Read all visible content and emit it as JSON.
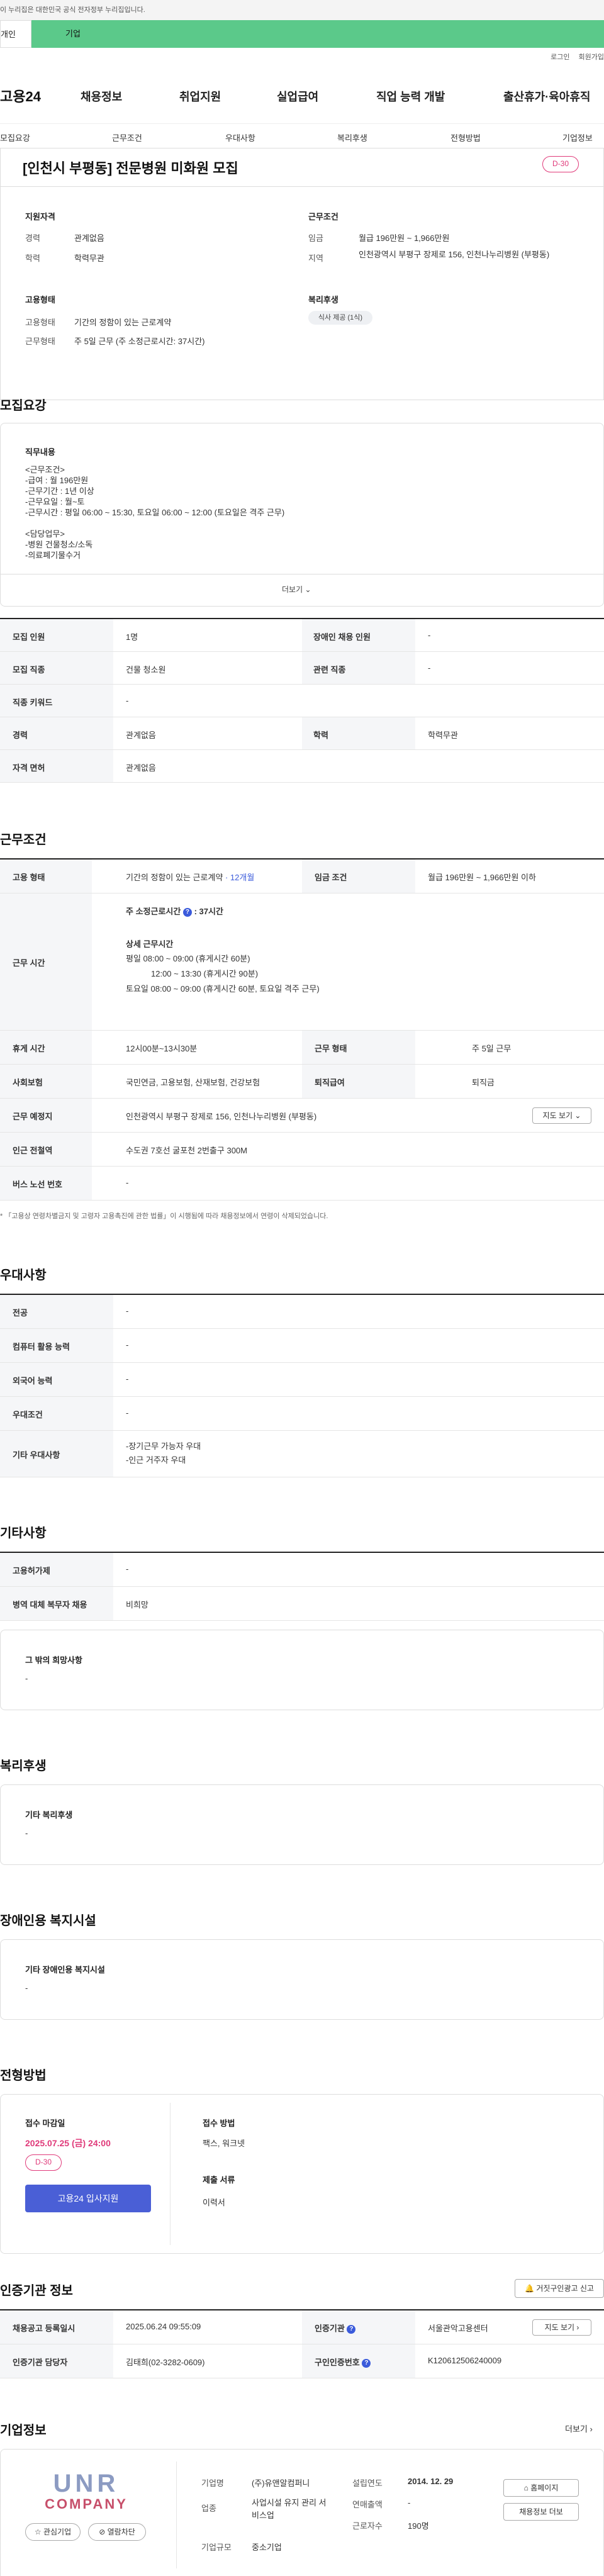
{
  "gov_banner": "이 누리집은 대한민국 공식 전자정부 누리집입니다.",
  "top_tabs": [
    "개인",
    "기업"
  ],
  "top_links": [
    "로그인",
    "회원가입"
  ],
  "logo": "고용24",
  "gnb": [
    "채용정보",
    "취업지원",
    "실업급여",
    "직업 능력 개발",
    "출산휴가·육아휴직"
  ],
  "snb": [
    "모집요강",
    "근무조건",
    "우대사항",
    "복리후생",
    "전형방법",
    "기업정보"
  ],
  "header": {
    "title": "[인천시 부평동] 전문병원 미화원 모집",
    "dday": "D-30"
  },
  "summary": {
    "qual_title": "지원자격",
    "career_label": "경력",
    "career_value": "관계없음",
    "edu_label": "학력",
    "edu_value": "학력무관",
    "cond_title": "근무조건",
    "wage_label": "임금",
    "wage_value": "월급 196만원 ~ 1,966만원",
    "region_label": "지역",
    "region_value": "인천광역시 부평구 장제로 156, 인천나누리병원 (부평동)",
    "emp_title": "고용형태",
    "emptype_label": "고용형태",
    "emptype_value": "기간의 정함이 있는 근로계약",
    "worktype_label": "근무형태",
    "worktype_value": "주 5일 근무 (주 소정근로시간: 37시간)",
    "welfare_title": "복리후생",
    "welfare_badge": "식사 제공 (1식)"
  },
  "recruit": {
    "section": "모집요강",
    "duty_title": "직무내용",
    "duty_lines": [
      "<근무조건>",
      "-급여 : 월 196만원",
      "-근무기간 : 1년 이상",
      "-근무요일 : 월~토",
      "-근무시간 : 평일 06:00 ~ 15:30, 토요일 06:00 ~ 12:00 (토요일은 격주 근무)",
      "",
      "<담당업무>",
      "-병원 건물청소/소독",
      "-의료폐기물수거"
    ],
    "more": "더보기",
    "rows": [
      {
        "k1": "모집 인원",
        "v1": "1명",
        "k2": "장애인 채용 인원",
        "v2": "-"
      },
      {
        "k1": "모집 직종",
        "v1": "건물 청소원",
        "k2": "관련 직종",
        "v2": "-"
      },
      {
        "k1": "직종 키워드",
        "v1": "-"
      },
      {
        "k1": "경력",
        "v1": "관계없음",
        "k2": "학력",
        "v2": "학력무관"
      },
      {
        "k1": "자격 면허",
        "v1": "관계없음"
      }
    ]
  },
  "workcond": {
    "section": "근무조건",
    "emp_label": "고용 형태",
    "emp_value": "기간의 정함이 있는 근로계약",
    "emp_months": "· 12개월",
    "wage_label": "임금 조건",
    "wage_value": "월급 196만원 ~ 1,966만원 이하",
    "time_label": "근무 시간",
    "weekly": "주 소정근로시간",
    "weekly_hours": ": 37시간",
    "detail_title": "상세 근무시간",
    "detail_lines": [
      "평일 08:00 ~ 09:00 (휴게시간 60분)",
      "12:00 ~ 13:30 (휴게시간 90분)",
      "토요일 08:00 ~ 09:00 (휴게시간 60분, 토요일 격주 근무)"
    ],
    "break_label": "휴게 시간",
    "break_value": "12시00분~13시30분",
    "form_label": "근무 형태",
    "form_value": "주 5일 근무",
    "ins_label": "사회보험",
    "ins_value": "국민연금, 고용보험, 산재보험, 건강보험",
    "sev_label": "퇴직급여",
    "sev_value": "퇴직금",
    "place_label": "근무 예정지",
    "place_value": "인천광역시 부평구 장제로 156, 인천나누리병원 (부평동)",
    "map_btn": "지도 보기",
    "station_label": "인근 전철역",
    "station_value": "수도권 7호선 굴포천 2번출구 300M",
    "bus_label": "버스 노선 번호",
    "bus_value": "-",
    "note": "* 「고용상 연령차별금지 및 고령자 고용촉진에 관한 법률」이 시행됨에 따라 채용정보에서 연령이 삭제되었습니다."
  },
  "pref": {
    "section": "우대사항",
    "rows": [
      {
        "k": "전공",
        "v": "-"
      },
      {
        "k": "컴퓨터 활용 능력",
        "v": "-"
      },
      {
        "k": "외국어 능력",
        "v": "-"
      },
      {
        "k": "우대조건",
        "v": "-"
      }
    ],
    "etc_label": "기타 우대사항",
    "etc_lines": [
      "-장기근무 가능자 우대",
      "-인근 거주자 우대"
    ]
  },
  "other": {
    "section": "기타사항",
    "rows": [
      {
        "k": "고용허가제",
        "v": "-"
      },
      {
        "k": "병역 대체 복무자 채용",
        "v": "비희망"
      }
    ],
    "etc_title": "그 밖의 희망사항",
    "etc_value": "-"
  },
  "welfare": {
    "section": "복리후생",
    "title": "기타 복리후생",
    "value": "-"
  },
  "disabled": {
    "section": "장애인용 복지시설",
    "title": "기타 장애인용 복지시설",
    "value": "-"
  },
  "selection": {
    "section": "전형방법",
    "deadline_title": "접수 마감일",
    "deadline": "2025.07.25 (금) 24:00",
    "dday": "D-30",
    "apply_btn": "고용24 입사지원",
    "method_title": "접수 방법",
    "method_value": "팩스, 워크넷",
    "docs_title": "제출 서류",
    "docs_value": "이력서"
  },
  "cert": {
    "section": "인증기관 정보",
    "false_btn": "거짓구인광고 신고",
    "reg_label": "채용공고 등록일시",
    "reg_value": "2025.06.24 09:55:09",
    "org_label": "인증기관",
    "org_value": "서울관악고용센터",
    "map_btn": "지도 보기",
    "mgr_label": "인증기관 담당자",
    "mgr_value": "김태희(02-3282-0609)",
    "no_label": "구인인증번호",
    "no_value": "K120612506240009"
  },
  "company": {
    "section": "기업정보",
    "more": "더보기",
    "logo_top": "UNR",
    "logo_bottom": "COMPANY",
    "name_label": "기업명",
    "name_value": "(주)유앤알컴퍼니",
    "ind_label": "업종",
    "ind_value": "사업시설 유지 관리 서비스업",
    "size_label": "기업규모",
    "size_value": "중소기업",
    "est_label": "설립연도",
    "est_value": "2014. 12. 29",
    "sales_label": "연매출액",
    "sales_value": "-",
    "staff_label": "근로자수",
    "staff_value": "190명",
    "fav_btn": "관심기업",
    "block_btn": "열람차단",
    "home_btn": "홈페이지",
    "jobs_btn": "채용정보 더보"
  },
  "colors": {
    "accent_green": "#5bc98a",
    "dday_pink": "#e03a7a",
    "primary_blue": "#4a5fd6"
  }
}
